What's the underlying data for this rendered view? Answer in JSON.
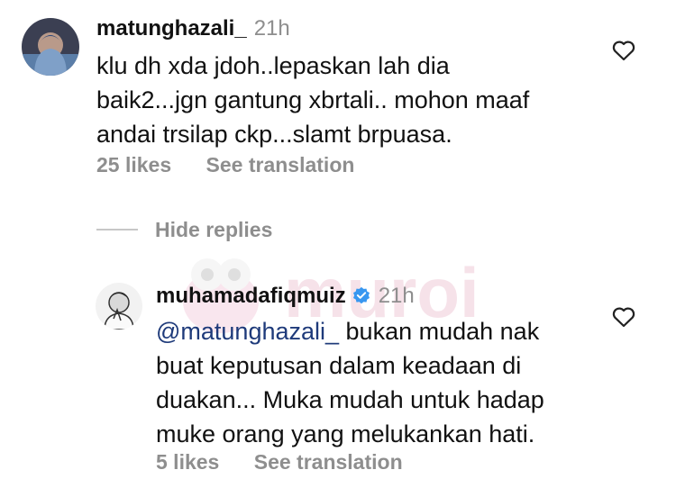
{
  "comment1": {
    "username": "matunghazali_",
    "time": "21h",
    "lines": [
      "klu dh xda jdoh..lepaskan lah dia",
      "baik2...jgn gantung xbrtali.. mohon maaf",
      "andai trsilap ckp...slamt brpuasa."
    ],
    "likes": "25 likes",
    "translate": "See translation",
    "heart_icon": "heart-outline-icon"
  },
  "replies_toggle": {
    "label": "Hide replies"
  },
  "reply1": {
    "username": "muhamadafiqmuiz",
    "verified_icon": "verified-badge-icon",
    "time": "21h",
    "mention": "@matunghazali_",
    "line1_rest": " bukan mudah nak",
    "lines": [
      "buat keputusan dalam keadaan di",
      "duakan... Muka mudah untuk hadap",
      "muke orang yang melukankan hati."
    ],
    "likes": "5 likes",
    "translate": "See translation",
    "heart_icon": "heart-outline-icon"
  },
  "watermark": {
    "text": "muroi"
  },
  "colors": {
    "verified": "#3897f0",
    "meta": "#8e8e8e",
    "mention": "#1e3a7a"
  }
}
